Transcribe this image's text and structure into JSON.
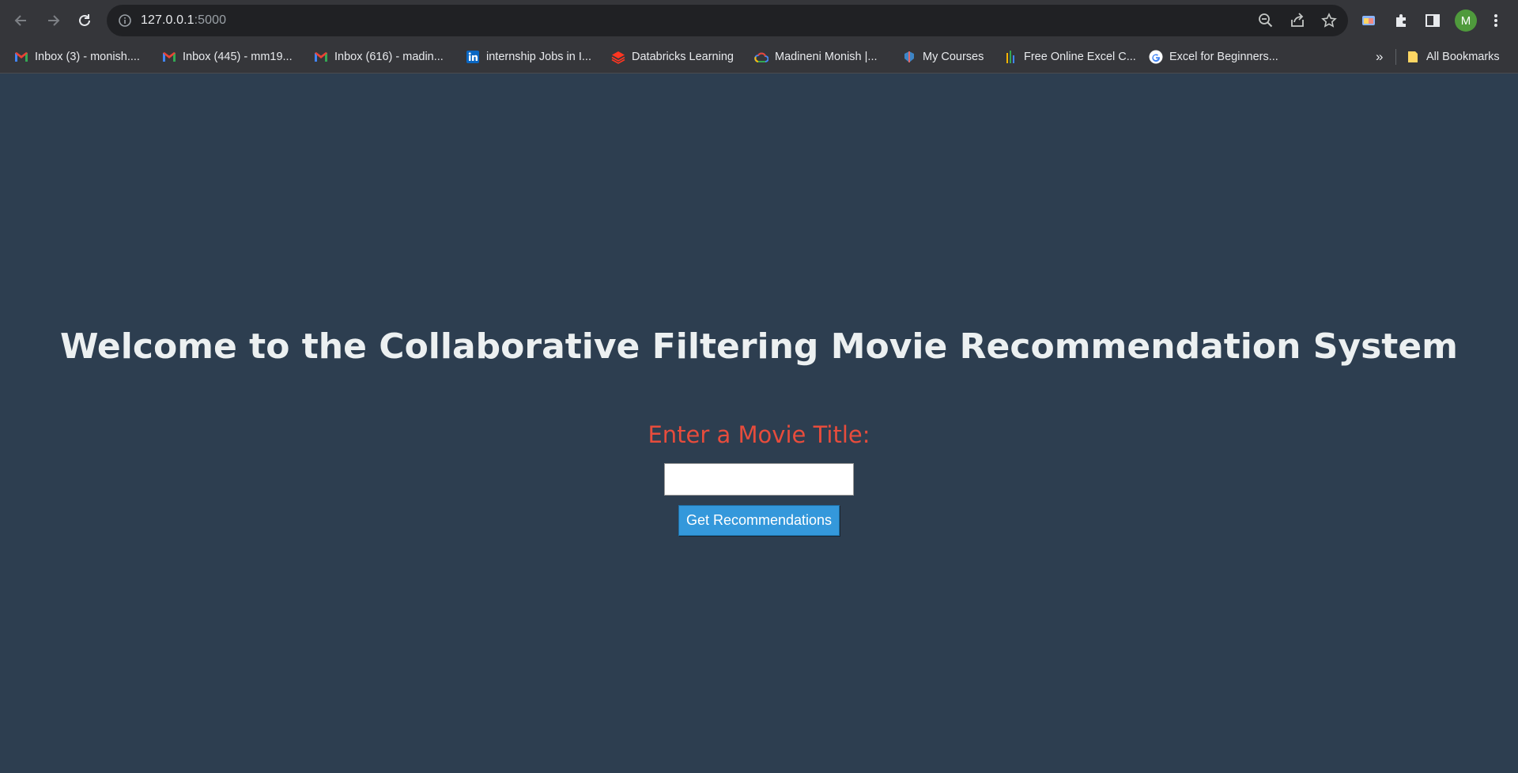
{
  "browser": {
    "url_host": "127.0.0.1",
    "url_port": ":5000",
    "avatar_letter": "M",
    "bookmarks": [
      {
        "label": "Inbox (3) - monish....",
        "icon": "gmail-icon"
      },
      {
        "label": "Inbox (445) - mm19...",
        "icon": "gmail-icon"
      },
      {
        "label": "Inbox (616) - madin...",
        "icon": "gmail-icon"
      },
      {
        "label": "internship Jobs in I...",
        "icon": "linkedin-icon"
      },
      {
        "label": "Databricks Learning",
        "icon": "databricks-icon"
      },
      {
        "label": "Madineni Monish |...",
        "icon": "google-cloud-icon"
      },
      {
        "label": "My Courses",
        "icon": "courses-icon"
      },
      {
        "label": "Free Online Excel C...",
        "icon": "excel-chart-icon"
      },
      {
        "label": "Excel for Beginners...",
        "icon": "google-icon"
      }
    ],
    "overflow_label": "»",
    "all_bookmarks_label": "All Bookmarks"
  },
  "page": {
    "title": "Welcome to the Collaborative Filtering Movie Recommendation System",
    "input_label": "Enter a Movie Title:",
    "input_value": "",
    "submit_label": "Get Recommendations"
  },
  "colors": {
    "background": "#2d3e50",
    "title": "#ecf0f1",
    "label": "#e74c3c",
    "button": "#3498db"
  }
}
